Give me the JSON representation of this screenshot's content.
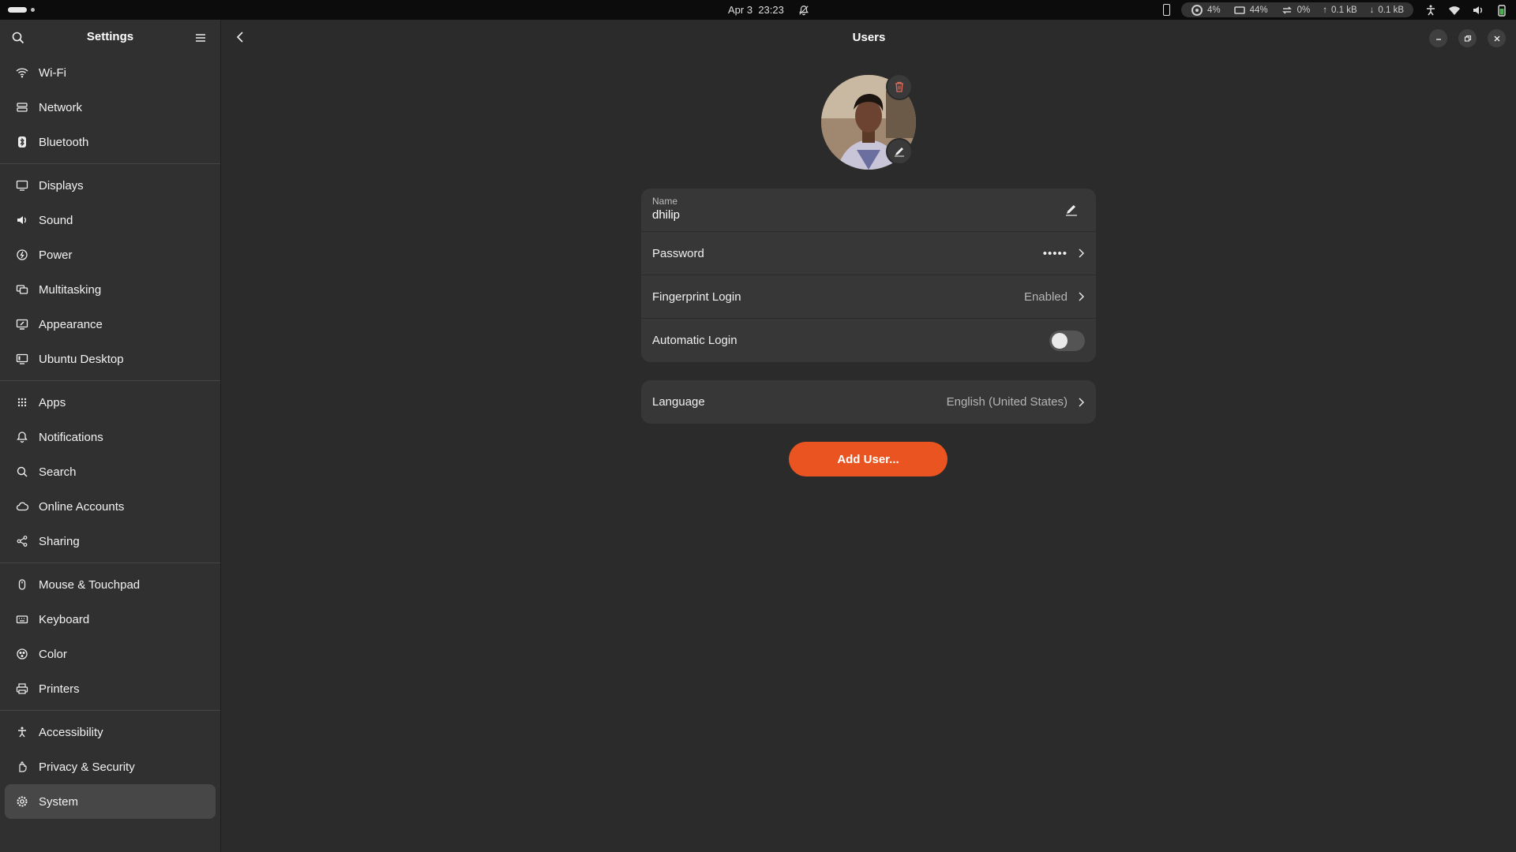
{
  "topbar": {
    "date": "Apr 3",
    "time": "23:23",
    "cpu": "4%",
    "memory": "44%",
    "swap": "0%",
    "upload": "0.1 kB",
    "download": "0.1 kB"
  },
  "sidebar": {
    "title": "Settings",
    "groups": [
      [
        "Wi-Fi",
        "Network",
        "Bluetooth"
      ],
      [
        "Displays",
        "Sound",
        "Power",
        "Multitasking",
        "Appearance",
        "Ubuntu Desktop"
      ],
      [
        "Apps",
        "Notifications",
        "Search",
        "Online Accounts",
        "Sharing"
      ],
      [
        "Mouse & Touchpad",
        "Keyboard",
        "Color",
        "Printers"
      ],
      [
        "Accessibility",
        "Privacy & Security",
        "System"
      ]
    ],
    "active": "System"
  },
  "main": {
    "title": "Users",
    "name_caption": "Name",
    "name_value": "dhilip",
    "password_label": "Password",
    "password_value": "•••••",
    "fingerprint_label": "Fingerprint Login",
    "fingerprint_value": "Enabled",
    "autologin_label": "Automatic Login",
    "autologin_enabled": false,
    "language_label": "Language",
    "language_value": "English (United States)",
    "add_user_label": "Add User..."
  },
  "colors": {
    "accent": "#e95420",
    "background": "#2b2b2b",
    "sidebar": "#303030",
    "card": "#373737"
  }
}
